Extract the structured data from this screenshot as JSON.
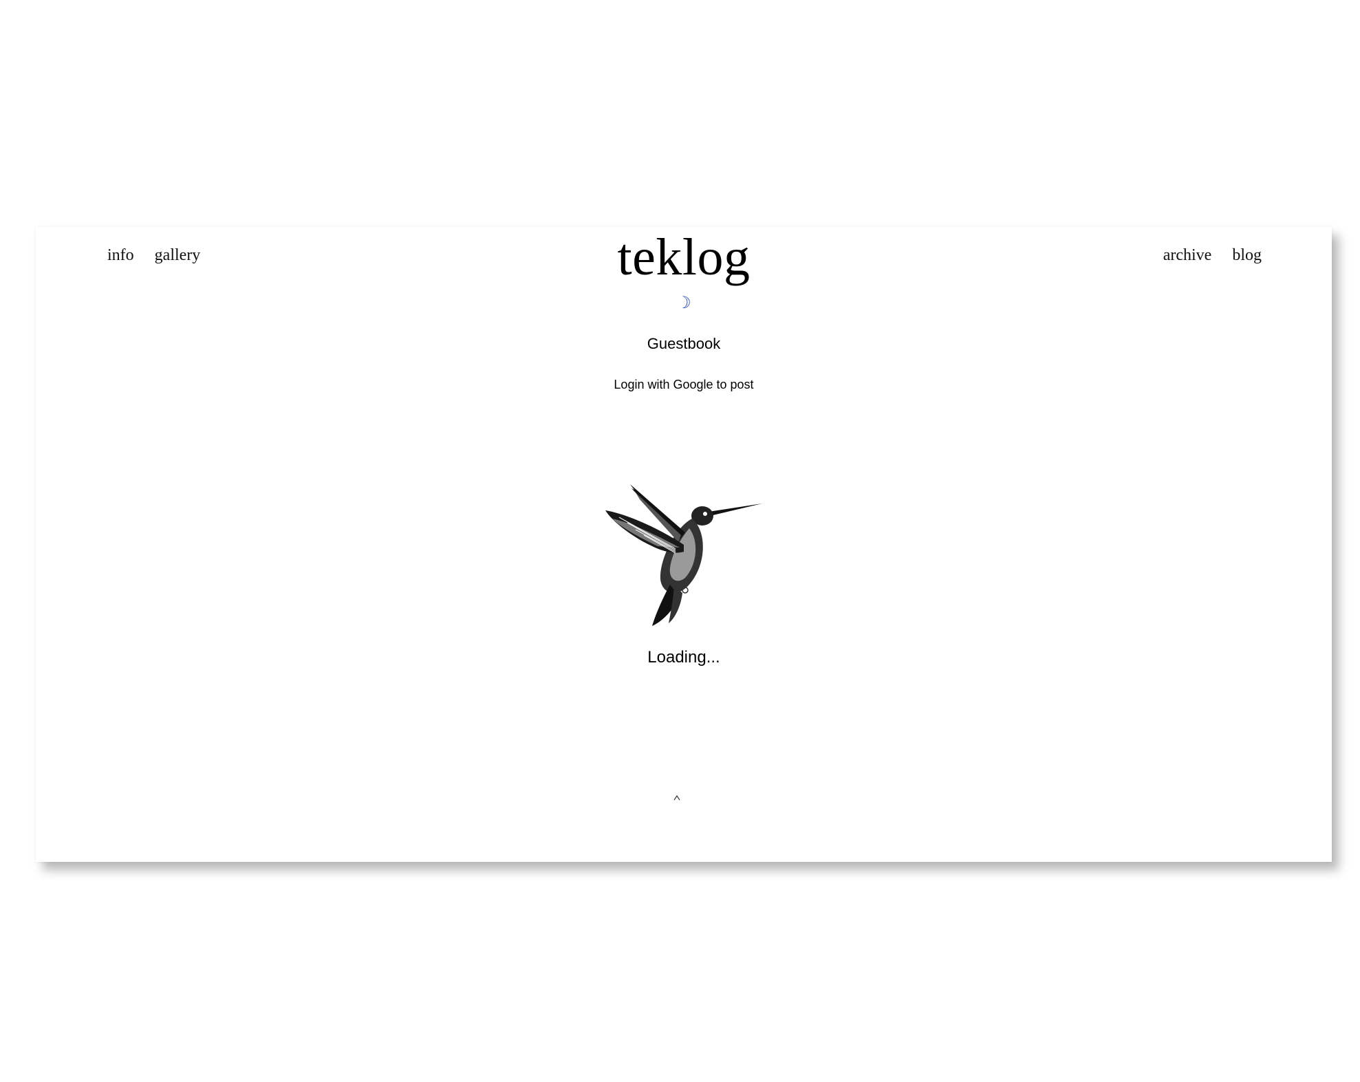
{
  "header": {
    "brand": "teklog",
    "nav_left": [
      {
        "label": "info"
      },
      {
        "label": "gallery"
      }
    ],
    "nav_right": [
      {
        "label": "archive"
      },
      {
        "label": "blog"
      }
    ],
    "theme_toggle": {
      "glyph": "☽",
      "icon": "moon-icon",
      "color": "#2a4db0"
    }
  },
  "guestbook": {
    "title": "Guestbook",
    "login_text": "Login with Google to post"
  },
  "loader": {
    "icon": "hummingbird-illustration",
    "text": "Loading..."
  }
}
